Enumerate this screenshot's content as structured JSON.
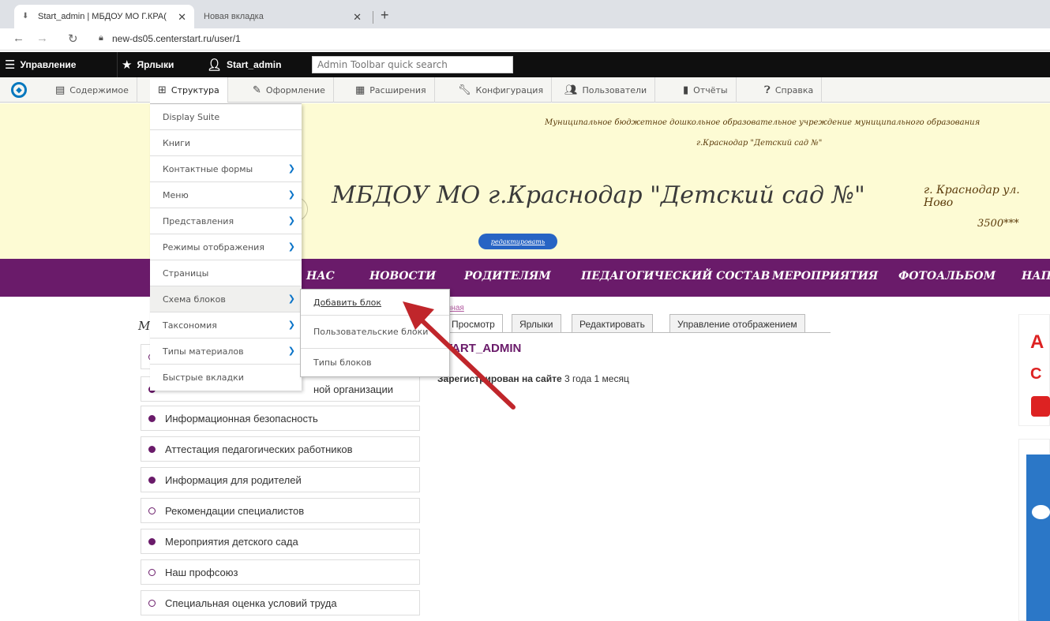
{
  "browser": {
    "tabs": [
      {
        "title": "Start_admin | МБДОУ МО Г.КРА(",
        "active": true
      },
      {
        "title": "Новая вкладка",
        "active": false
      }
    ],
    "new_tab_icon": "plus-icon",
    "close_icon": "close-icon",
    "url": "new-ds05.centerstart.ru/user/1"
  },
  "admin_toolbar": {
    "manage_label": "Управление",
    "shortcuts_label": "Ярлыки",
    "user_label": "Start_admin",
    "search_placeholder": "Admin Toolbar quick search"
  },
  "admin_tray": {
    "items": [
      {
        "label": "Содержимое",
        "icon": "file-icon"
      },
      {
        "label": "Структура",
        "icon": "sitemap-icon"
      },
      {
        "label": "Оформление",
        "icon": "paintbrush-icon"
      },
      {
        "label": "Расширения",
        "icon": "puzzle-icon"
      },
      {
        "label": "Конфигурация",
        "icon": "wrench-icon"
      },
      {
        "label": "Пользователи",
        "icon": "people-icon"
      },
      {
        "label": "Отчёты",
        "icon": "bar-chart-icon"
      },
      {
        "label": "Справка",
        "icon": "help-icon"
      }
    ]
  },
  "header": {
    "org_line1": "Муниципальное бюджетное дошкольное образовательное учреждение муниципального образования",
    "org_line2": "г.Краснодар \"Детский сад №\"",
    "logo_text": "МБДОУ МО г.Краснодар \"Детский сад №\"",
    "address_line1": "г. Краснодар ул. Ново",
    "address_line2": "3500***",
    "edit_button": "редактировать"
  },
  "main_nav": {
    "items": [
      "НАС",
      "НОВОСТИ",
      "РОДИТЕЛЯМ",
      "ПЕДАГОГИЧЕСКИЙ СОСТАВ",
      "МЕРОПРИЯТИЯ",
      "ФОТОАЛЬБОМ",
      "НАП"
    ]
  },
  "structure_menu": {
    "items": [
      {
        "label": "Display Suite",
        "has_submenu": false
      },
      {
        "label": "Книги",
        "has_submenu": false
      },
      {
        "label": "Контактные формы",
        "has_submenu": true
      },
      {
        "label": "Меню",
        "has_submenu": true
      },
      {
        "label": "Представления",
        "has_submenu": true
      },
      {
        "label": "Режимы отображения",
        "has_submenu": true
      },
      {
        "label": "Страницы",
        "has_submenu": false
      },
      {
        "label": "Схема блоков",
        "has_submenu": true
      },
      {
        "label": "Таксономия",
        "has_submenu": true
      },
      {
        "label": "Типы материалов",
        "has_submenu": true
      },
      {
        "label": "Быстрые вкладки",
        "has_submenu": false
      }
    ],
    "chevron_icon": "chevron-right-icon"
  },
  "block_submenu": {
    "items": [
      "Добавить блок",
      "Пользовательские блоки",
      "Типы блоков"
    ]
  },
  "sidebar": {
    "title": "М",
    "partial_row_text": "ной организации",
    "items": [
      {
        "label": "Информационная безопасность",
        "filled": true
      },
      {
        "label": "Аттестация педагогических работников",
        "filled": true
      },
      {
        "label": "Информация для родителей",
        "filled": true
      },
      {
        "label": "Рекомендации специалистов",
        "filled": false
      },
      {
        "label": "Мероприятия детского сада",
        "filled": true
      },
      {
        "label": "Наш профсоюз",
        "filled": false
      },
      {
        "label": "Специальная оценка условий труда",
        "filled": false
      }
    ]
  },
  "content": {
    "breadcrumb": "вная",
    "tabs": [
      "Просмотр",
      "Ярлыки",
      "Редактировать",
      "Управление отображением"
    ],
    "username": "TART_ADMIN",
    "registered_label": "Зарегистрирован на сайте",
    "registered_value": "3 года 1 месяц"
  },
  "right_widget": {
    "letter1": "А",
    "letter2": "С"
  },
  "colors": {
    "purple": "#6a1b6a",
    "header_bg": "#fdfbd4",
    "annotation_arrow": "#c0262b",
    "link_blue": "#0b74c8"
  }
}
